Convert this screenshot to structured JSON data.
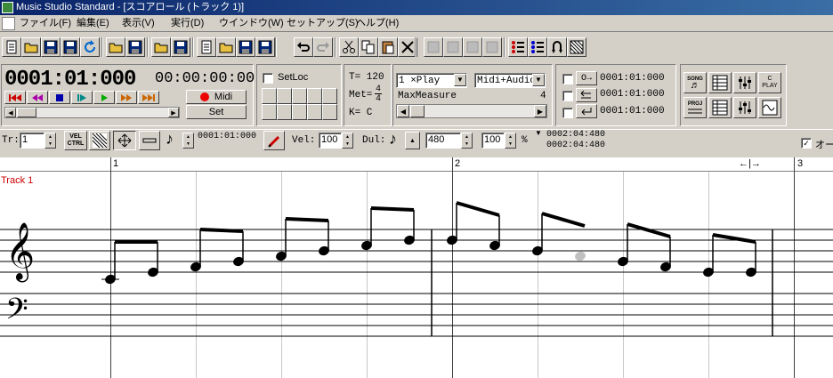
{
  "window": {
    "title": "Music Studio Standard - [スコアロール (トラック 1)]"
  },
  "menu": [
    "ファイル(F)",
    "編集(E)",
    "表示(V)",
    "実行(D)",
    "ウインドウ(W)",
    "セットアップ(S)",
    "ヘルプ(H)"
  ],
  "toolbar": {
    "icons": [
      "new-icon",
      "open-icon",
      "save-icon",
      "save-as-icon",
      "reload-icon",
      "open-alt-icon",
      "save-alt-icon",
      "open-song-icon",
      "save-song-icon",
      "document-icon",
      "open-doc-icon",
      "save-doc-icon",
      "save-doc-alt-icon",
      "undo-icon",
      "redo-icon",
      "cut-icon",
      "copy-icon",
      "paste-icon",
      "delete-icon",
      "paste-insert-icon",
      "paste-merge-icon",
      "insert-icon",
      "merge-icon",
      "list-icon",
      "list-alt-icon",
      "loop-icon",
      "grid-icon"
    ]
  },
  "transport": {
    "position": "0001:01:000",
    "time": "00:00:00:00",
    "midi_label": "Midi",
    "set_label": "Set"
  },
  "setloc": {
    "label": "SetLoc"
  },
  "info": {
    "tempo": "T= 120",
    "met_label": "Met=",
    "met_num": "4",
    "met_den": "4",
    "key": "K= C"
  },
  "play": {
    "mode": "1 ×Play",
    "source": "Midi+Audio",
    "maxmeasure_label": "MaxMeasure",
    "maxmeasure_value": "4"
  },
  "locators": [
    {
      "time": "0001:01:000"
    },
    {
      "time": "0001:01:000"
    },
    {
      "time": "0001:01:000"
    }
  ],
  "right_tools": {
    "song_label": "SONG",
    "proj_label": "PROJ",
    "cplay_label": "C PLAY"
  },
  "edit": {
    "track_label": "Tr:",
    "track_value": "1",
    "vel_ctrl_label": "VEL CTRL",
    "position": "0001:01:000",
    "vel_label": "Vel:",
    "vel_value": "100",
    "dul_label": "Dul:",
    "dul_value": "480",
    "percent_value": "100",
    "percent_sign": "%",
    "end_time_1": "0002:04:480",
    "end_time_2": "0002:04:480",
    "ortho_label": "オー"
  },
  "score": {
    "track_name": "Track 1",
    "measures": [
      "1",
      "2",
      "3"
    ],
    "zoom_label": "←|→"
  }
}
